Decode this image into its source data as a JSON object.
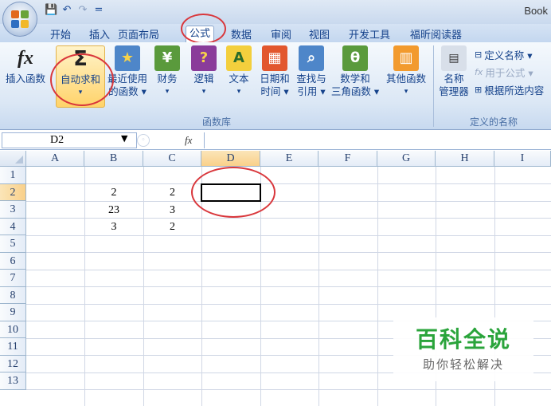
{
  "window": {
    "title": "Book"
  },
  "quick_access": {
    "save_icon": "save-icon",
    "undo_icon": "undo-icon",
    "redo_icon": "redo-icon",
    "customize": "="
  },
  "tabs": [
    {
      "label": "开始"
    },
    {
      "label": "插入"
    },
    {
      "label": "页面布局"
    },
    {
      "label": "公式"
    },
    {
      "label": "数据"
    },
    {
      "label": "审阅"
    },
    {
      "label": "视图"
    },
    {
      "label": "开发工具"
    },
    {
      "label": "福昕阅读器"
    }
  ],
  "ribbon": {
    "function_library": {
      "label": "函数库",
      "buttons": [
        {
          "line1": "插入函数",
          "line2": "",
          "icon": "fx"
        },
        {
          "line1": "自动求和",
          "line2": "▾",
          "icon": "Σ"
        },
        {
          "line1": "最近使用",
          "line2": "的函数 ▾",
          "icon": "★"
        },
        {
          "line1": "财务",
          "line2": "▾",
          "icon": "¥"
        },
        {
          "line1": "逻辑",
          "line2": "▾",
          "icon": "?"
        },
        {
          "line1": "文本",
          "line2": "▾",
          "icon": "A"
        },
        {
          "line1": "日期和",
          "line2": "时间 ▾",
          "icon": "▦"
        },
        {
          "line1": "查找与",
          "line2": "引用 ▾",
          "icon": "⌕"
        },
        {
          "line1": "数学和",
          "line2": "三角函数 ▾",
          "icon": "θ"
        },
        {
          "line1": "其他函数",
          "line2": "▾",
          "icon": "▥"
        }
      ]
    },
    "defined_names": {
      "label": "定义的名称",
      "manager_line1": "名称",
      "manager_line2": "管理器",
      "define_name": "定义名称 ▾",
      "use_in_formula": "用于公式 ▾",
      "create_from_selection": "根据所选内容"
    }
  },
  "formula_bar": {
    "name_box": "D2",
    "fx": "fx",
    "value": ""
  },
  "columns": [
    "A",
    "B",
    "C",
    "D",
    "E",
    "F",
    "G",
    "H",
    "I"
  ],
  "rows": [
    "1",
    "2",
    "3",
    "4",
    "5",
    "6",
    "7",
    "8",
    "9",
    "10",
    "11",
    "12",
    "13"
  ],
  "cells": {
    "B2": "2",
    "C2": "2",
    "B3": "23",
    "C3": "3",
    "B4": "3",
    "C4": "2"
  },
  "watermark": {
    "title": "百科全说",
    "subtitle": "助你轻松解决"
  },
  "colors": {
    "accent": "#15428b",
    "highlight": "#d9373c",
    "watermark_green": "#2aa43b"
  }
}
